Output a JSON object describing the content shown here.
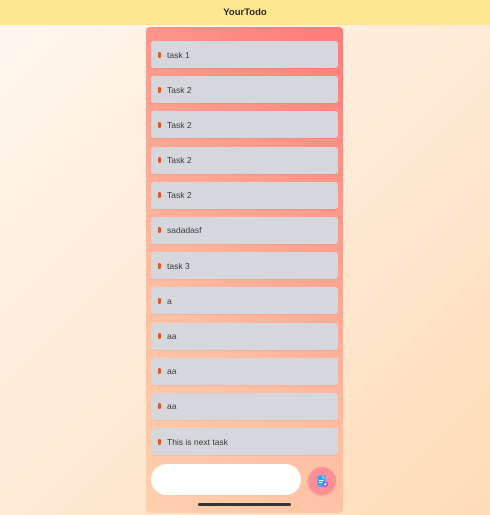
{
  "app": {
    "title": "YourTodo"
  },
  "tasks": [
    {
      "label": "task 1"
    },
    {
      "label": "Task 2"
    },
    {
      "label": "Task 2"
    },
    {
      "label": "Task 2"
    },
    {
      "label": "Task 2"
    },
    {
      "label": "sadadasf"
    },
    {
      "label": "task 3"
    },
    {
      "label": "a"
    },
    {
      "label": "aa"
    },
    {
      "label": "aa"
    },
    {
      "label": "aa"
    },
    {
      "label": "This is next task"
    }
  ],
  "composer": {
    "value": "",
    "add_icon": "note-add-icon"
  },
  "colors": {
    "topbar": "#ffe690",
    "task_bg": "#d5d7dd",
    "bullet": "#e0561d",
    "add_button": "#ff8e95"
  }
}
